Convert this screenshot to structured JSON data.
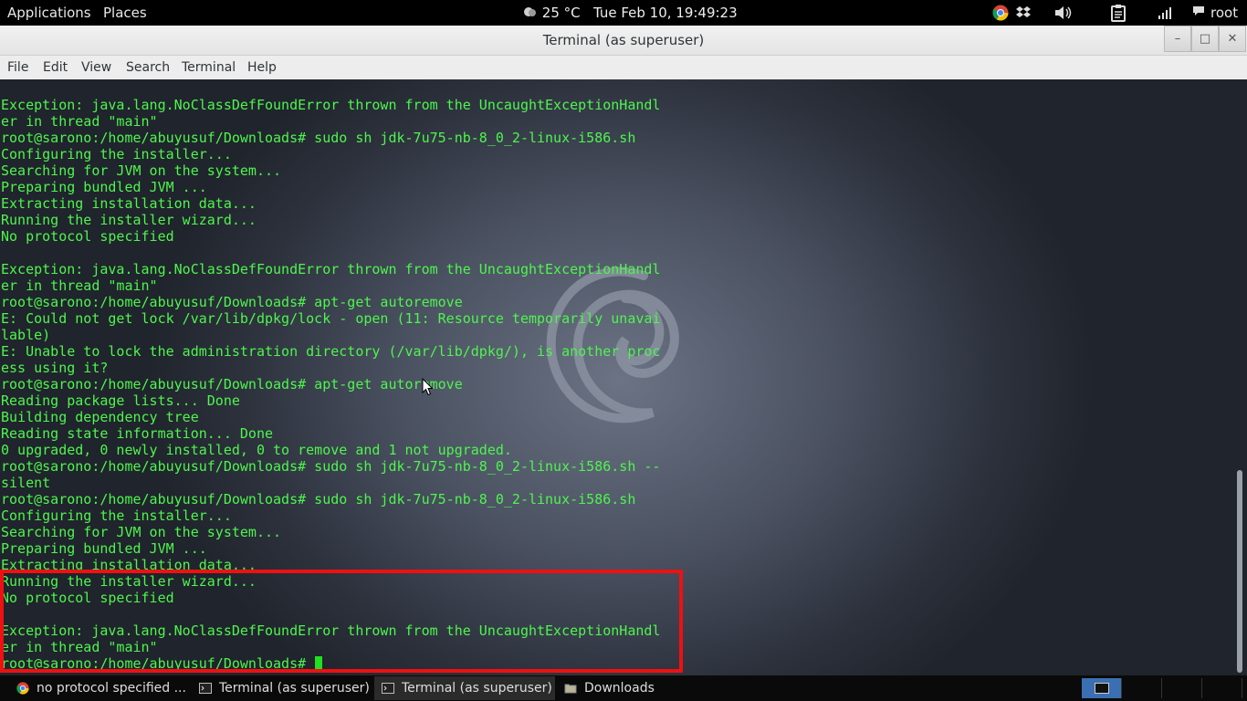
{
  "top_panel": {
    "applications_label": "Applications",
    "places_label": "Places",
    "weather": "25 °C",
    "clock": "Tue Feb 10, 19:49:23",
    "user": "root"
  },
  "window": {
    "title": "Terminal (as superuser)",
    "minimize_label": "–",
    "maximize_label": "□",
    "close_label": "✕"
  },
  "menubar": {
    "items": [
      "File",
      "Edit",
      "View",
      "Search",
      "Terminal",
      "Help"
    ]
  },
  "terminal": {
    "lines": [
      "Exception: java.lang.NoClassDefFoundError thrown from the UncaughtExceptionHandl",
      "er in thread \"main\"",
      "root@sarono:/home/abuyusuf/Downloads# sudo sh jdk-7u75-nb-8_0_2-linux-i586.sh",
      "Configuring the installer...",
      "Searching for JVM on the system...",
      "Preparing bundled JVM ...",
      "Extracting installation data...",
      "Running the installer wizard...",
      "No protocol specified",
      "",
      "Exception: java.lang.NoClassDefFoundError thrown from the UncaughtExceptionHandl",
      "er in thread \"main\"",
      "root@sarono:/home/abuyusuf/Downloads# apt-get autoremove",
      "E: Could not get lock /var/lib/dpkg/lock - open (11: Resource temporarily unavai",
      "lable)",
      "E: Unable to lock the administration directory (/var/lib/dpkg/), is another proc",
      "ess using it?",
      "root@sarono:/home/abuyusuf/Downloads# apt-get autoremove",
      "Reading package lists... Done",
      "Building dependency tree",
      "Reading state information... Done",
      "0 upgraded, 0 newly installed, 0 to remove and 1 not upgraded.",
      "root@sarono:/home/abuyusuf/Downloads# sudo sh jdk-7u75-nb-8_0_2-linux-i586.sh --",
      "silent",
      "root@sarono:/home/abuyusuf/Downloads# sudo sh jdk-7u75-nb-8_0_2-linux-i586.sh",
      "Configuring the installer...",
      "Searching for JVM on the system...",
      "Preparing bundled JVM ...",
      "Extracting installation data...",
      "Running the installer wizard...",
      "No protocol specified",
      "",
      "Exception: java.lang.NoClassDefFoundError thrown from the UncaughtExceptionHandl",
      "er in thread \"main\""
    ],
    "prompt": "root@sarono:/home/abuyusuf/Downloads# ",
    "text_color": "#4ef54e",
    "highlight_color": "#ee1111"
  },
  "taskbar": {
    "tasks": [
      {
        "label": "no protocol specified ...",
        "icon": "chrome-icon",
        "active": false
      },
      {
        "label": "Terminal (as superuser)",
        "icon": "terminal-icon",
        "active": false
      },
      {
        "label": "Terminal (as superuser)",
        "icon": "terminal-icon",
        "active": true
      },
      {
        "label": "Downloads",
        "icon": "folder-icon",
        "active": false
      }
    ]
  }
}
